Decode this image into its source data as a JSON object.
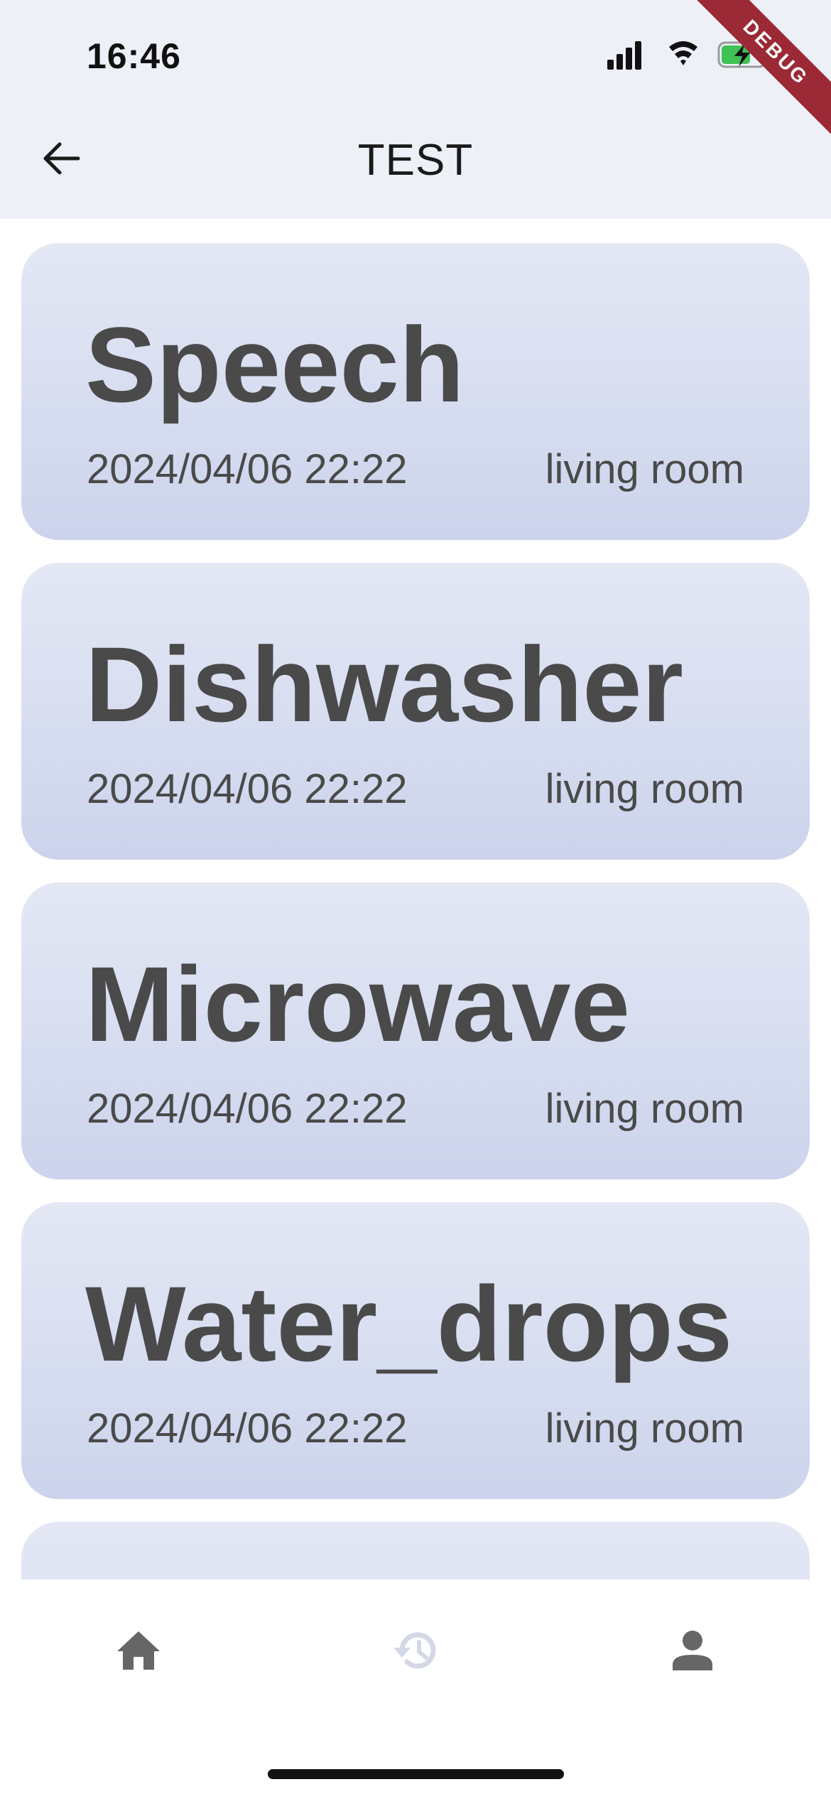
{
  "status_bar": {
    "time": "16:46",
    "debug_label": "DEBUG"
  },
  "header": {
    "title": "TEST"
  },
  "cards": [
    {
      "title": "Speech",
      "date": "2024/04/06 22:22",
      "location": "living room"
    },
    {
      "title": "Dishwasher",
      "date": "2024/04/06 22:22",
      "location": "living room"
    },
    {
      "title": "Microwave",
      "date": "2024/04/06 22:22",
      "location": "living room"
    },
    {
      "title": "Water_drops",
      "date": "2024/04/06 22:22",
      "location": "living room"
    }
  ],
  "bottom_nav": {
    "items": [
      {
        "icon": "home-icon",
        "active": true
      },
      {
        "icon": "history-icon",
        "active": false
      },
      {
        "icon": "person-icon",
        "active": true
      }
    ]
  },
  "colors": {
    "header_bg": "#eef0f8",
    "card_gradient_top": "#e4e8f5",
    "card_gradient_bottom": "#ccd4ec",
    "card_text": "#4a4a4a",
    "nav_icon": "#666666",
    "nav_icon_inactive": "#d4d8e6",
    "debug_ribbon": "#9c2936"
  }
}
